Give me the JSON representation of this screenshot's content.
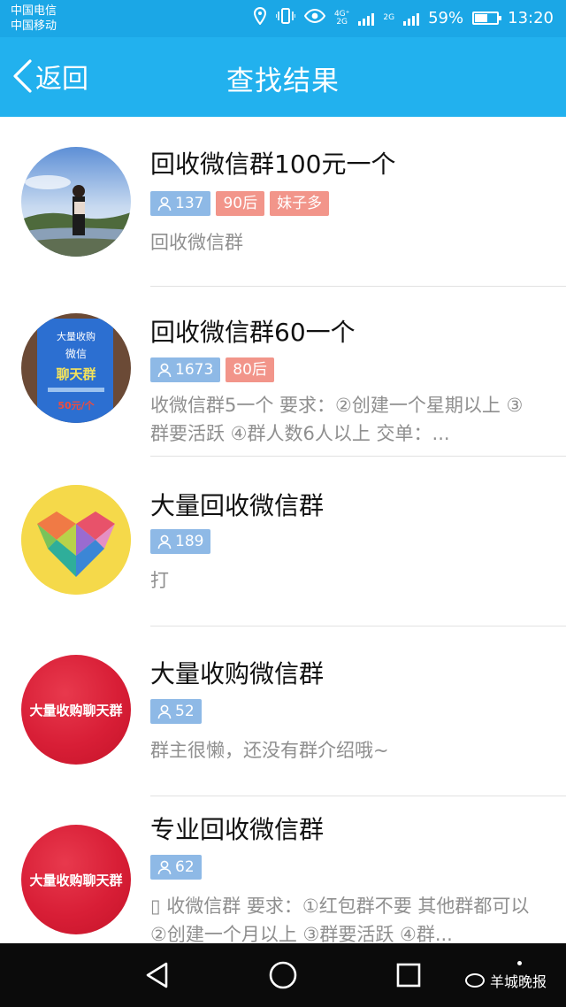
{
  "status_bar": {
    "carrier_1": "中国电信",
    "carrier_2": "中国移动",
    "network_1": "4G⁺",
    "network_1b": "2G",
    "network_2": "2G",
    "battery": "59%",
    "battery_level": 0.59,
    "time": "13:20"
  },
  "nav": {
    "back_label": "返回",
    "title": "查找结果"
  },
  "results": [
    {
      "name": "回收微信群100元一个",
      "members": "137",
      "tags": [
        "90后",
        "妹子多"
      ],
      "description": "回收微信群",
      "avatar": "photo-woman-landscape"
    },
    {
      "name": "回收微信群60一个",
      "members": "1673",
      "tags": [
        "80后"
      ],
      "description": "收微信群5一个 要求：②创建一个星期以上 ③群要活跃 ④群人数6人以上 交单：...",
      "avatar": "poster-blue",
      "avatar_text_1": "大量收购",
      "avatar_text_2": "微信",
      "avatar_text_3": "聊天群",
      "avatar_text_4": "50元/个"
    },
    {
      "name": "大量回收微信群",
      "members": "189",
      "tags": [],
      "description": "打",
      "avatar": "heart-yellow"
    },
    {
      "name": "大量收购微信群",
      "members": "52",
      "tags": [],
      "description": "群主很懒，还没有群介绍哦~",
      "avatar": "red-circle",
      "avatar_text": "大量收购聊天群"
    },
    {
      "name": "专业回收微信群",
      "members": "62",
      "tags": [],
      "description": "▯ 收微信群 要求：①红包群不要 其他群都可以 ②创建一个月以上 ③群要活跃 ④群...",
      "avatar": "red-circle",
      "avatar_text": "大量收购聊天群"
    }
  ],
  "bottom_nav": {
    "icons": [
      "back-triangle-icon",
      "home-circle-icon",
      "recents-square-icon"
    ],
    "watermark": "羊城晚报"
  },
  "colors": {
    "header": "#22b1ee",
    "members_tag": "#8eb9e6",
    "label_tag": "#f2958a"
  }
}
